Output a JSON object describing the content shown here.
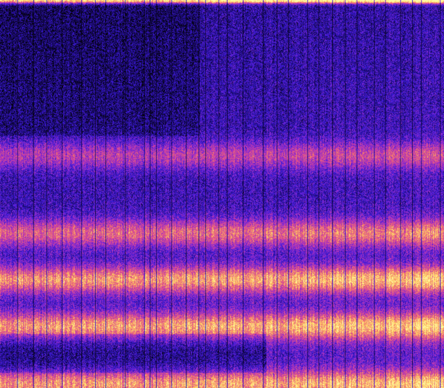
{
  "image": {
    "kind": "spectrogram",
    "colormap": [
      "#000000",
      "#1a0a6e",
      "#3a1ad8",
      "#8a2ad0",
      "#d040a0",
      "#f07070",
      "#ffd060",
      "#fff8a0"
    ],
    "background_color": "#2a1590",
    "bands": [
      {
        "level": 0.4,
        "strength": 0.55
      },
      {
        "level": 0.6,
        "strength": 0.75
      },
      {
        "level": 0.72,
        "strength": 0.95
      },
      {
        "level": 0.84,
        "strength": 0.95
      },
      {
        "level": 0.99,
        "strength": 0.9
      }
    ],
    "top_edge_strength": 0.85
  }
}
